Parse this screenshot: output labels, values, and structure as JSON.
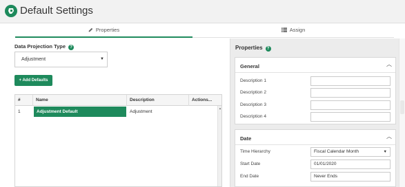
{
  "header": {
    "title": "Default Settings"
  },
  "tabs": [
    {
      "label": "Properties",
      "icon": "pencil-icon",
      "active": true
    },
    {
      "label": "Assign",
      "icon": "list-icon",
      "active": false
    }
  ],
  "left": {
    "projection_label": "Data Projection Type",
    "projection_value": "Adjustment",
    "add_button": "+ Add Defaults",
    "grid": {
      "columns": [
        "#",
        "Name",
        "Description",
        "Actions..."
      ],
      "rows": [
        {
          "num": "1",
          "name": "Adjustment Default",
          "description": "Adjustment"
        }
      ]
    }
  },
  "right": {
    "title": "Properties",
    "general": {
      "title": "General",
      "fields": [
        {
          "label": "Description 1",
          "value": ""
        },
        {
          "label": "Description 2",
          "value": ""
        },
        {
          "label": "Description 3",
          "value": ""
        },
        {
          "label": "Description 4",
          "value": ""
        }
      ]
    },
    "date": {
      "title": "Date",
      "fields": [
        {
          "label": "Time Hierarchy",
          "value": "Fiscal Calendar Month"
        },
        {
          "label": "Start Date",
          "value": "01/01/2020"
        },
        {
          "label": "End Date",
          "value": "Never Ends"
        }
      ]
    }
  },
  "colors": {
    "accent": "#1e8a5c"
  }
}
